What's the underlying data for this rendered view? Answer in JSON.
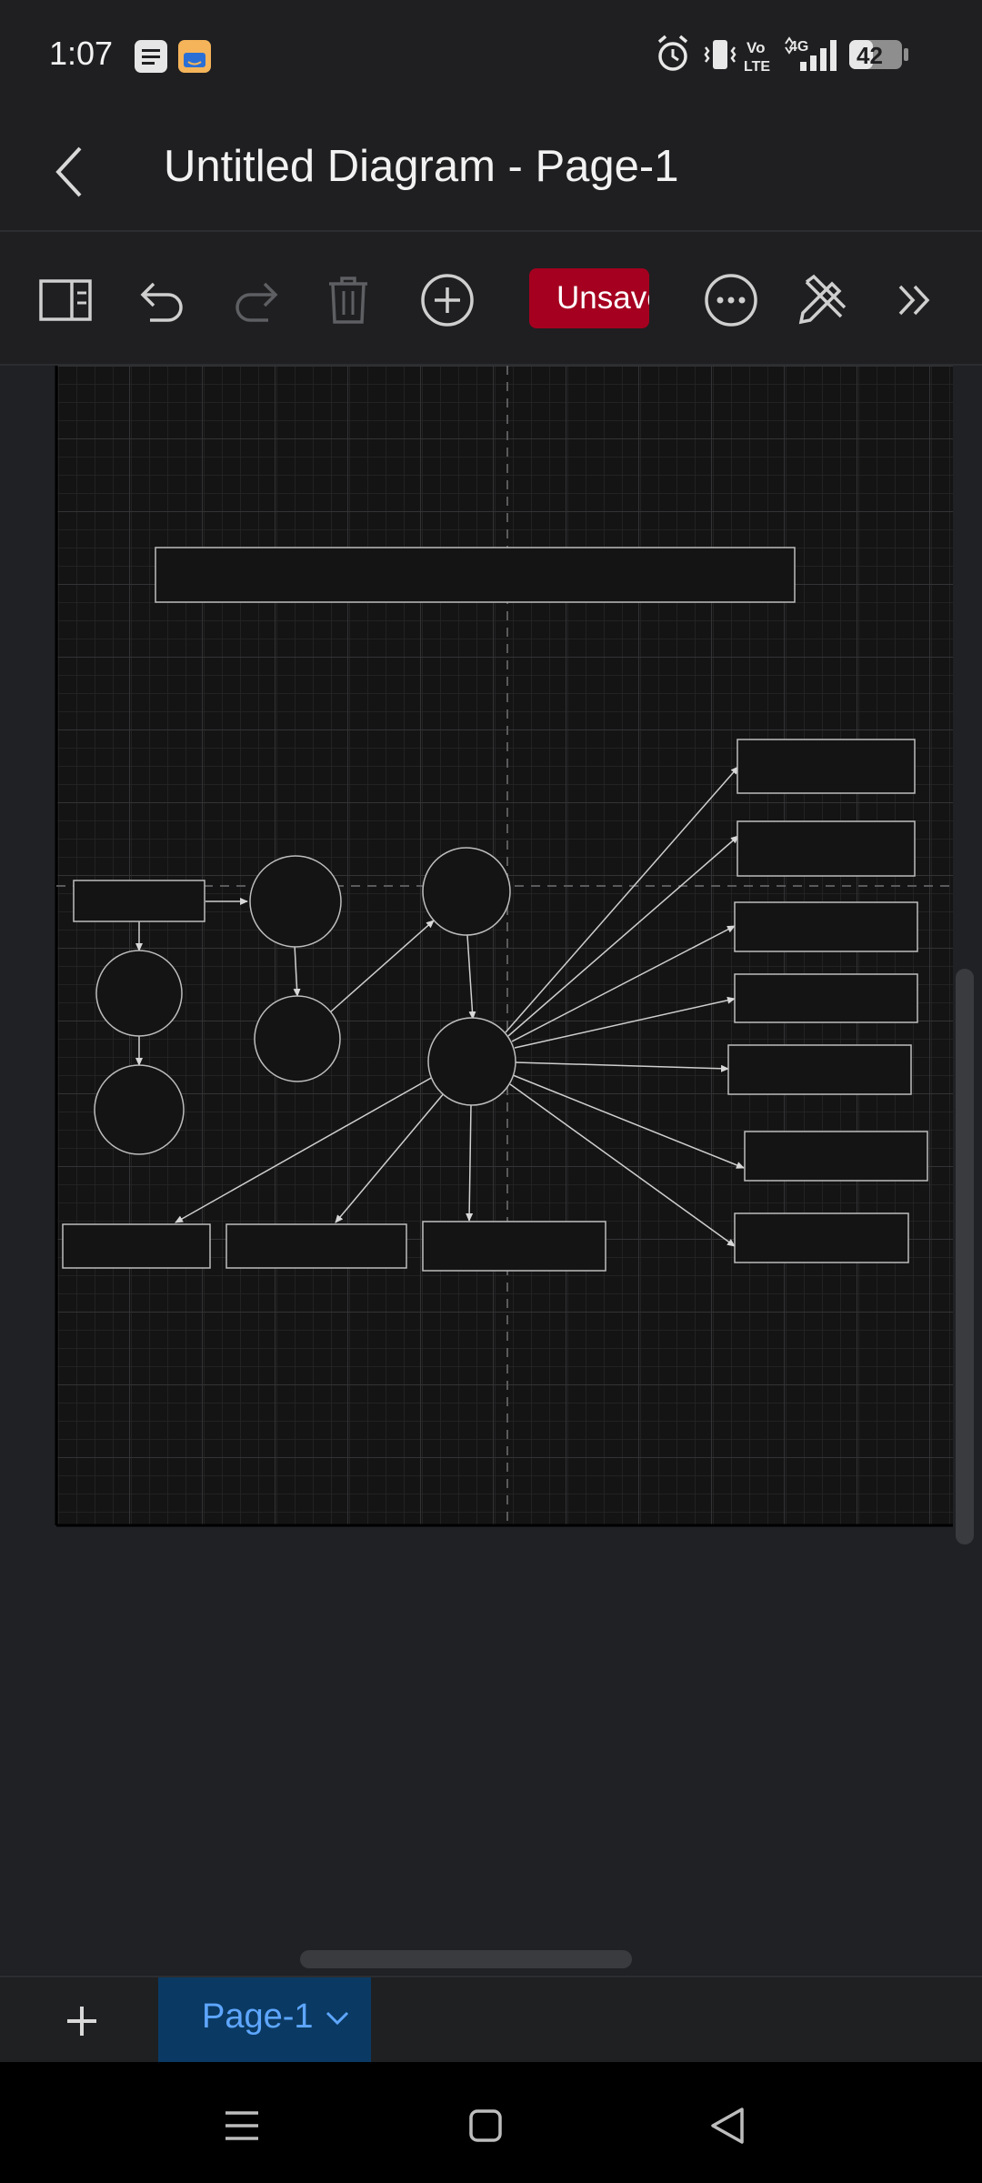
{
  "status_bar": {
    "time": "1:07",
    "battery": "42",
    "network": "4G",
    "volte": "Vo LTE",
    "icons": [
      "notes-icon",
      "shopping-icon",
      "alarm-icon",
      "vibrate-icon",
      "volte-icon",
      "signal-icon",
      "battery-icon"
    ]
  },
  "header": {
    "title": "Untitled Diagram - Page-1",
    "back_icon": "chevron-left-icon"
  },
  "toolbar": {
    "unsaved_label": "Unsaved",
    "icons": [
      "format-panel-icon",
      "undo-icon",
      "redo-icon",
      "delete-icon",
      "add-icon",
      "more-icon",
      "edit-style-icon",
      "expand-icon"
    ]
  },
  "diagram": {
    "shapes": [
      {
        "id": "title-box",
        "kind": "rectangle",
        "label": ""
      },
      {
        "id": "rect-left-1",
        "kind": "rectangle",
        "label": ""
      },
      {
        "id": "circle-1",
        "kind": "circle",
        "label": ""
      },
      {
        "id": "circle-2",
        "kind": "circle",
        "label": ""
      },
      {
        "id": "circle-3",
        "kind": "circle",
        "label": ""
      },
      {
        "id": "circle-4",
        "kind": "circle",
        "label": ""
      },
      {
        "id": "circle-5",
        "kind": "circle",
        "label": ""
      },
      {
        "id": "circle-6",
        "kind": "circle",
        "label": ""
      },
      {
        "id": "circle-hub",
        "kind": "circle",
        "label": ""
      },
      {
        "id": "rect-right-1",
        "kind": "rectangle",
        "label": ""
      },
      {
        "id": "rect-right-2",
        "kind": "rectangle",
        "label": ""
      },
      {
        "id": "rect-right-3",
        "kind": "rectangle",
        "label": ""
      },
      {
        "id": "rect-right-4",
        "kind": "rectangle",
        "label": ""
      },
      {
        "id": "rect-right-5",
        "kind": "rectangle",
        "label": ""
      },
      {
        "id": "rect-right-6",
        "kind": "rectangle",
        "label": ""
      },
      {
        "id": "rect-right-7",
        "kind": "rectangle",
        "label": ""
      },
      {
        "id": "rect-bottom-1",
        "kind": "rectangle",
        "label": ""
      },
      {
        "id": "rect-bottom-2",
        "kind": "rectangle",
        "label": ""
      },
      {
        "id": "rect-bottom-3",
        "kind": "rectangle",
        "label": ""
      }
    ]
  },
  "page_tabs": {
    "add_icon": "plus-icon",
    "active_tab": "Page-1",
    "tab_menu_icon": "chevron-down-icon"
  },
  "nav_bar": {
    "icons": [
      "menu-icon",
      "home-icon",
      "back-icon"
    ]
  },
  "colors": {
    "accent_red": "#a5001f",
    "tab_active_bg": "#0a3a63",
    "tab_active_text": "#5ea6ff",
    "canvas_bg": "#141415"
  }
}
